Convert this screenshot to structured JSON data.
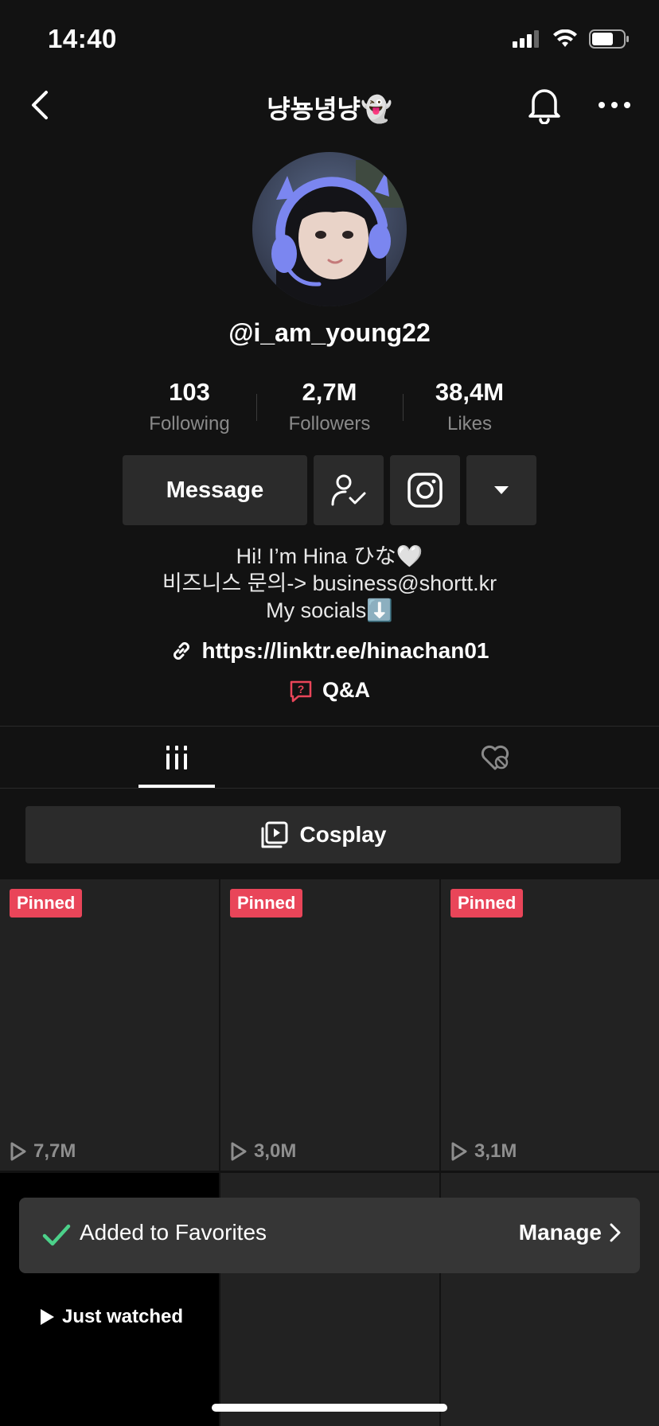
{
  "status_bar": {
    "time": "14:40"
  },
  "nav": {
    "title": "냥뇽녕냥👻"
  },
  "profile": {
    "username": "@i_am_young22",
    "stats": [
      {
        "value": "103",
        "label": "Following"
      },
      {
        "value": "2,7M",
        "label": "Followers"
      },
      {
        "value": "38,4M",
        "label": "Likes"
      }
    ],
    "message_label": "Message",
    "bio": [
      "Hi! I’m Hina ひな🤍",
      "비즈니스 문의-> business@shortt.kr",
      "My socials⬇️"
    ],
    "link": "https://linktr.ee/hinachan01",
    "qa_label": "Q&A"
  },
  "playlist": {
    "label": "Cosplay"
  },
  "videos": [
    {
      "badge": "Pinned",
      "views": "7,7M"
    },
    {
      "badge": "Pinned",
      "views": "3,0M"
    },
    {
      "badge": "Pinned",
      "views": "3,1M"
    }
  ],
  "toast": {
    "text": "Added to Favorites",
    "action": "Manage"
  },
  "just_watched": "Just watched",
  "colors": {
    "background": "#121212",
    "accent_red": "#e94559",
    "check_green": "#4cd18a"
  }
}
